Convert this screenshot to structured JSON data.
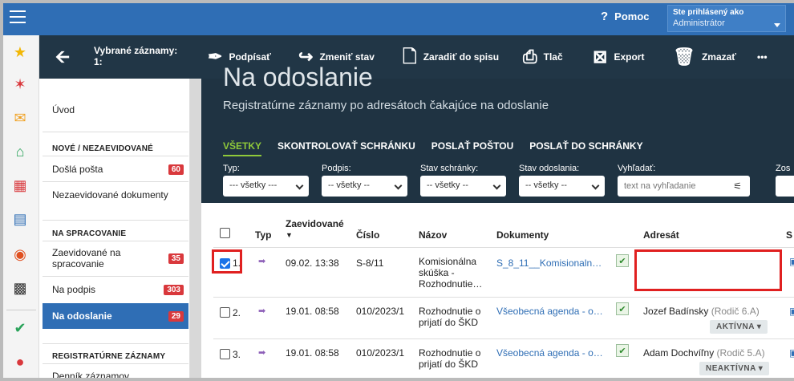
{
  "topbar": {
    "help_label": "Pomoc",
    "user_status": "Ste prihlásený ako",
    "user_name": "Administrátor"
  },
  "toolbar": {
    "selected_label": "Vybrané záznamy:",
    "selected_count": "1:",
    "sign": "Podpísať",
    "change_state": "Zmeniť stav",
    "file": "Zaradiť do spisu",
    "print": "Tlač",
    "export": "Export",
    "delete": "Zmazať",
    "more": "•••"
  },
  "nav": {
    "home": "Úvod",
    "sec_new": "NOVÉ / NEZAEVIDOVANÉ",
    "incoming": "Došlá pošta",
    "incoming_count": "60",
    "unregistered": "Nezaevidované dokumenty",
    "sec_processing": "NA SPRACOVANIE",
    "registered_l1": "Zaevidované na",
    "registered_l2": "spracovanie",
    "registered_count": "35",
    "to_sign": "Na podpis",
    "to_sign_count": "303",
    "to_send": "Na odoslanie",
    "to_send_count": "29",
    "sec_registry": "REGISTRATÚRNE ZÁZNAMY",
    "diary": "Denník záznamov"
  },
  "hero": {
    "title": "Na odoslanie",
    "subtitle": "Registratúrne záznamy po adresátoch čakajúce na odoslanie",
    "tabs": [
      "VŠETKY",
      "SKONTROLOVAŤ SCHRÁNKU",
      "POSLAŤ POŠTOU",
      "POSLAŤ DO SCHRÁNKY"
    ]
  },
  "filters": {
    "type_label": "Typ:",
    "type_value": "--- všetky ---",
    "sign_label": "Podpis:",
    "sign_value": "-- všetky --",
    "box_label": "Stav schránky:",
    "box_value": "-- všetky --",
    "send_label": "Stav odoslania:",
    "send_value": "-- všetky --",
    "search_label": "Vyhľadať:",
    "search_placeholder": "text na vyhľadanie",
    "cut_label": "Zos"
  },
  "table": {
    "headers": {
      "type": "Typ",
      "registered": "Zaevidované",
      "number": "Číslo",
      "name": "Názov",
      "docs": "Dokumenty",
      "addressee": "Adresát",
      "cut": "S"
    },
    "rows": [
      {
        "idx": "1.",
        "date": "09.02. 13:38",
        "number": "S-8/11",
        "name_l1": "Komisionálna",
        "name_l2": "skúška -",
        "name_l3": "Rozhodnutie…",
        "doc": "S_8_11__Komisionaln…",
        "addressee": "",
        "status": ""
      },
      {
        "idx": "2.",
        "date": "19.01. 08:58",
        "number": "010/2023/1",
        "name_l1": "Rozhodnutie o",
        "name_l2": "prijatí do ŠKD",
        "name_l3": "",
        "doc": "Všeobecná agenda - o…",
        "addressee": "Jozef Badínsky",
        "addressee_note": "(Rodič 6.A)",
        "status": "AKTÍVNA"
      },
      {
        "idx": "3.",
        "date": "19.01. 08:58",
        "number": "010/2023/1",
        "name_l1": "Rozhodnutie o",
        "name_l2": "prijatí do ŠKD",
        "name_l3": "",
        "doc": "Všeobecná agenda - o…",
        "addressee": "Adam Dochvíľny",
        "addressee_note": "(Rodič 5.A)",
        "status": "NEAKTÍVNA"
      }
    ]
  },
  "colors": {
    "brand": "#2f6eb5",
    "dark": "#1f3342",
    "accent": "#8fc93a",
    "badge": "#d9383c",
    "highlight": "#e02020"
  }
}
